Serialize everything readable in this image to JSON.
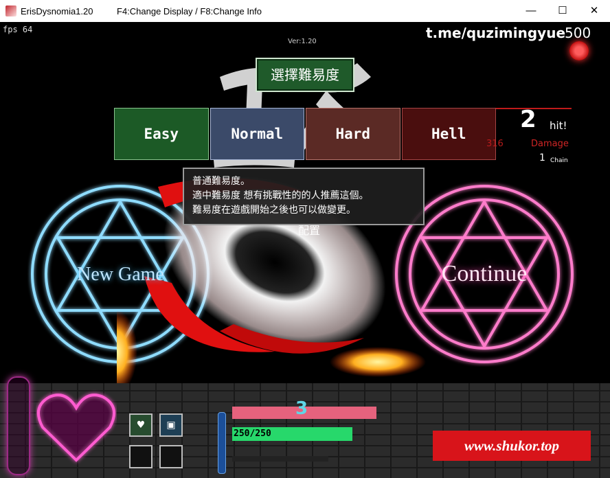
{
  "window": {
    "title": "ErisDysnomia1.20",
    "hint": "F4:Change Display / F8:Change Info",
    "minimize_glyph": "—",
    "maximize_glyph": "☐",
    "close_glyph": "✕"
  },
  "hud_top": {
    "fps": "fps 64",
    "version": "Ver:1.20",
    "watermark": "t.me/quzimingyue",
    "score": "500"
  },
  "difficulty": {
    "header": "選擇難易度",
    "tabs": [
      {
        "label": "Easy",
        "color": "#1c5a26"
      },
      {
        "label": "Normal",
        "color": "#3b4a69"
      },
      {
        "label": "Hard",
        "color": "#5b2a25"
      },
      {
        "label": "Hell",
        "color": "#4a0e0e"
      }
    ],
    "tooltip": {
      "line1": "普通難易度。",
      "line2": "適中難易度 想有挑戰性的的人推薦這個。",
      "line3": "難易度在遊戲開始之後也可以做變更。"
    },
    "config_label": "配置"
  },
  "combo": {
    "ghost_number": "170",
    "hits": "2",
    "hit_label": "hit!",
    "damage_value": "316",
    "damage_label": "Damage",
    "chain_value": "1",
    "chain_label": "Chain"
  },
  "menu": {
    "new_game": "New Game",
    "continue": "Continue"
  },
  "hud_bottom": {
    "counter": "3",
    "hp_text": "250/250",
    "hp_fraction": 1.0,
    "slots": [
      {
        "icon": "heart-potion-icon"
      },
      {
        "icon": "item-card-icon"
      },
      {
        "icon": "empty-slot"
      },
      {
        "icon": "empty-slot"
      }
    ],
    "watermark": "www.shukor.top"
  },
  "colors": {
    "accent_red": "#d8141a",
    "magic_blue": "#4fc8ff",
    "magic_pink": "#ff4fb4",
    "hp_green": "#27d86b"
  }
}
